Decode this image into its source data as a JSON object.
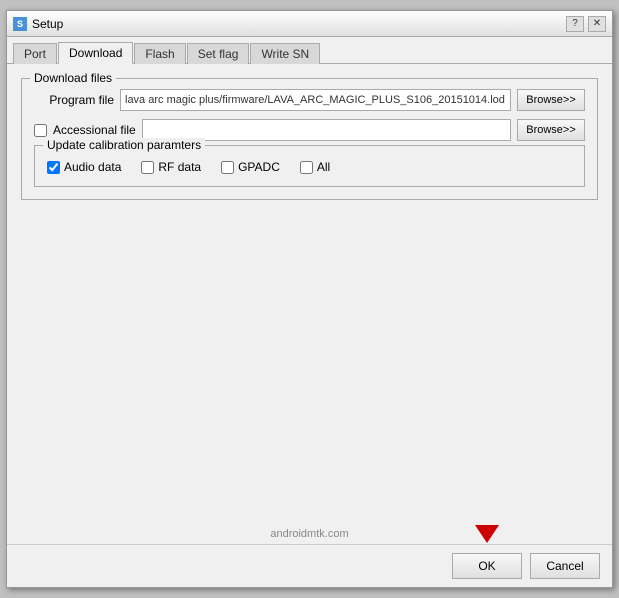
{
  "window": {
    "title": "Setup",
    "title_icon": "S",
    "help_btn": "?",
    "close_btn": "✕"
  },
  "tabs": [
    {
      "label": "Port",
      "active": false
    },
    {
      "label": "Download",
      "active": true
    },
    {
      "label": "Flash",
      "active": false
    },
    {
      "label": "Set flag",
      "active": false
    },
    {
      "label": "Write SN",
      "active": false
    }
  ],
  "download_files_group": "Download files",
  "program_file_label": "Program file",
  "program_file_value": "lava arc magic plus/firmware/LAVA_ARC_MAGIC_PLUS_S106_20151014.lod",
  "program_browse_label": "Browse>>",
  "accessional_file_label": "Accessional file",
  "accessional_file_value": "",
  "accessional_browse_label": "Browse>>",
  "calibration_group": "Update calibration paramters",
  "audio_data_label": "Audio data",
  "audio_data_checked": true,
  "rf_data_label": "RF data",
  "rf_data_checked": false,
  "gpadc_label": "GPADC",
  "gpadc_checked": false,
  "all_label": "All",
  "all_checked": false,
  "ok_label": "OK",
  "cancel_label": "Cancel",
  "watermark": "androidmtk.com",
  "footer_watermark": "androidmtk.com"
}
